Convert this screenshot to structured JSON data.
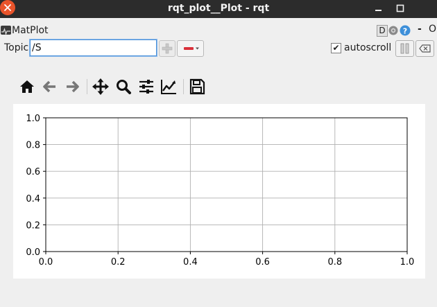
{
  "window": {
    "title": "rqt_plot__Plot - rqt"
  },
  "plugin": {
    "title": "MatPlot",
    "help_label": "D",
    "hide_label": "-",
    "close_label": "O"
  },
  "topic": {
    "label": "Topic",
    "value": "/S"
  },
  "controls": {
    "autoscroll_label": "autoscroll",
    "autoscroll_checked": true,
    "remove_color": "#d9303a"
  },
  "toolbar": {
    "icons": [
      "home-icon",
      "back-arrow-icon",
      "forward-arrow-icon",
      "pan-icon",
      "zoom-icon",
      "subplots-icon",
      "axes-icon",
      "save-icon"
    ]
  },
  "chart_data": {
    "type": "line",
    "title": "",
    "xlabel": "",
    "ylabel": "",
    "xlim": [
      0.0,
      1.0
    ],
    "ylim": [
      0.0,
      1.0
    ],
    "xticks": [
      "0.0",
      "0.2",
      "0.4",
      "0.6",
      "0.8",
      "1.0"
    ],
    "yticks": [
      "0.0",
      "0.2",
      "0.4",
      "0.6",
      "0.8",
      "1.0"
    ],
    "grid": true,
    "series": []
  }
}
